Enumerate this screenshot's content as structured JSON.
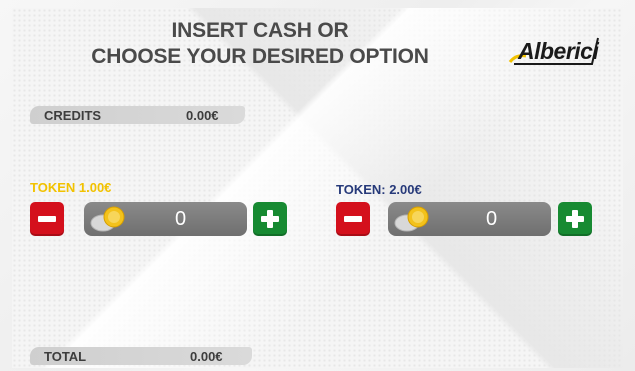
{
  "heading": {
    "line1": "INSERT CASH OR",
    "line2": "CHOOSE YOUR DESIRED OPTION"
  },
  "logo": {
    "text": "Alberici"
  },
  "credits": {
    "label": "CREDITS",
    "value": "0.00€"
  },
  "tokens": [
    {
      "label": "TOKEN 1.00€",
      "count": "0",
      "color": "#f2c200"
    },
    {
      "label": "TOKEN: 2.00€",
      "count": "0",
      "color": "#273a7a"
    }
  ],
  "total": {
    "label": "TOTAL",
    "value": "0.00€"
  },
  "colors": {
    "minus": "#d4101c",
    "plus": "#178a32",
    "counter": "#7a7a7a",
    "accent": "#f2c200"
  },
  "icons": [
    "minus-icon",
    "plus-icon",
    "coin-icon"
  ]
}
